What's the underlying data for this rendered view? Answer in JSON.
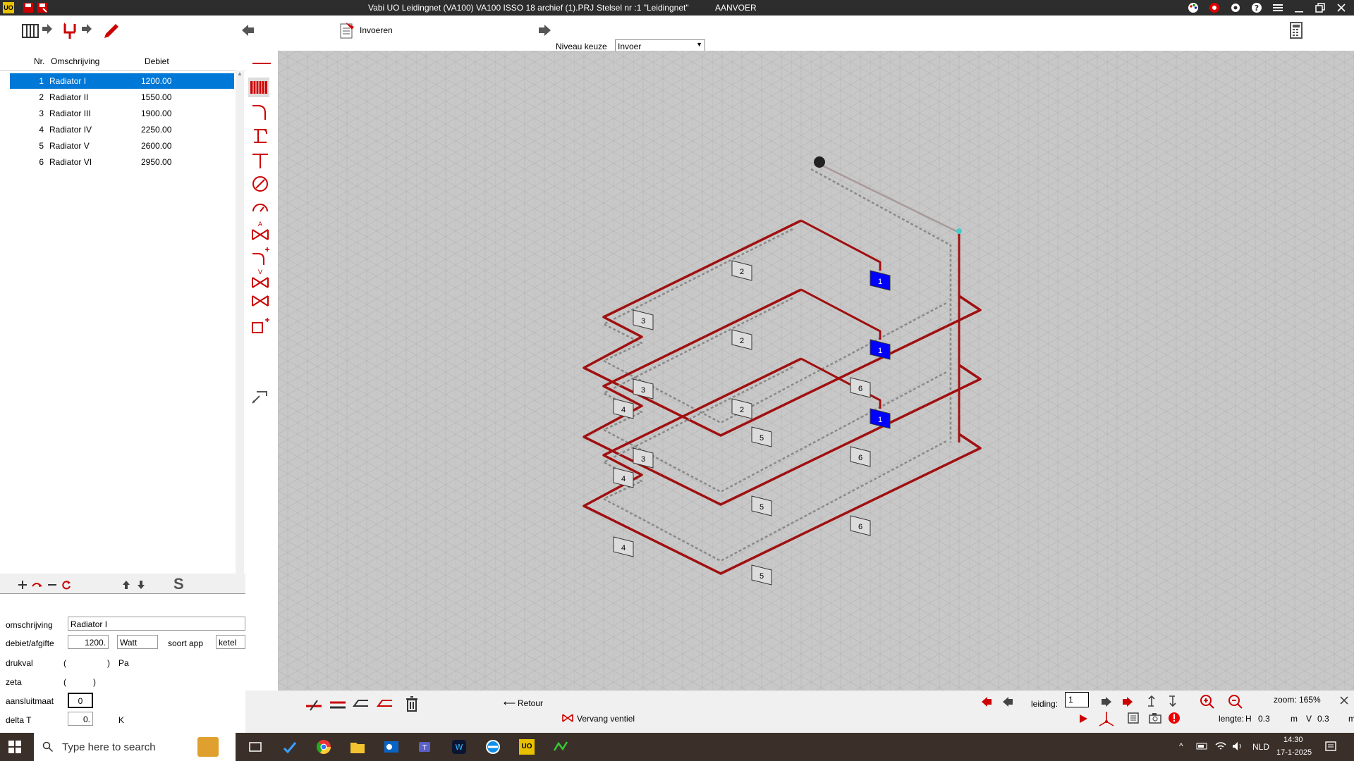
{
  "titlebar": {
    "title": "Vabi UO Leidingnet (VA100)  VA100 ISSO 18 archief (1).PRJ",
    "stelsel": "Stelsel nr   :1  \"Leidingnet\"",
    "mode": "AANVOER"
  },
  "toolbar": {
    "invoeren_label": "Invoeren",
    "niveau_label": "Niveau keuze",
    "niveau_value": "Invoer"
  },
  "list": {
    "col_nr": "Nr.",
    "col_omschrijving": "Omschrijving",
    "col_debiet": "Debiet",
    "rows": [
      {
        "nr": "1",
        "name": "Radiator I",
        "debiet": "1200.00"
      },
      {
        "nr": "2",
        "name": "Radiator II",
        "debiet": "1550.00"
      },
      {
        "nr": "3",
        "name": "Radiator III",
        "debiet": "1900.00"
      },
      {
        "nr": "4",
        "name": "Radiator IV",
        "debiet": "2250.00"
      },
      {
        "nr": "5",
        "name": "Radiator V",
        "debiet": "2600.00"
      },
      {
        "nr": "6",
        "name": "Radiator VI",
        "debiet": "2950.00"
      }
    ],
    "selected_index": 0
  },
  "form": {
    "omschrijving_label": "omschrijving",
    "omschrijving_value": "Radiator I",
    "debiet_label": "debiet/afgifte",
    "debiet_value": "1200.",
    "debiet_unit": "Watt",
    "soort_app_label": "soort app",
    "soort_app_value": "ketel",
    "drukval_label": "drukval",
    "drukval_open": "(",
    "drukval_close": ")",
    "drukval_unit": "Pa",
    "zeta_label": "zeta",
    "zeta_open": "(",
    "zeta_close": ")",
    "aansluitmaat_label": "aansluitmaat",
    "aansluitmaat_value": "0",
    "delta_t_label": "delta T",
    "delta_t_value": "0.",
    "delta_t_unit": "K",
    "list_tools_s": "S"
  },
  "canvas": {
    "node_labels": [
      "1",
      "2",
      "3",
      "4",
      "5",
      "6"
    ]
  },
  "bottombar": {
    "retour_label": "Retour",
    "vervang_label": "Vervang ventiel",
    "leiding_label": "leiding:",
    "leiding_value": "1",
    "zoom_label": "zoom: 165%",
    "lengte_label": "lengte:",
    "h_label": "H",
    "h_value": "0.3",
    "m1": "m",
    "v_label": "V",
    "v_value": "0.3",
    "m2": "m"
  },
  "taskbar": {
    "search_placeholder": "Type here to search",
    "lang": "NLD",
    "time": "14:30",
    "date": "17-1-2025"
  },
  "colors": {
    "pipe_supply": "#a01010",
    "pipe_return": "#8a8a8a",
    "radiator_active": "#0000ff",
    "selection": "#0078d7"
  }
}
